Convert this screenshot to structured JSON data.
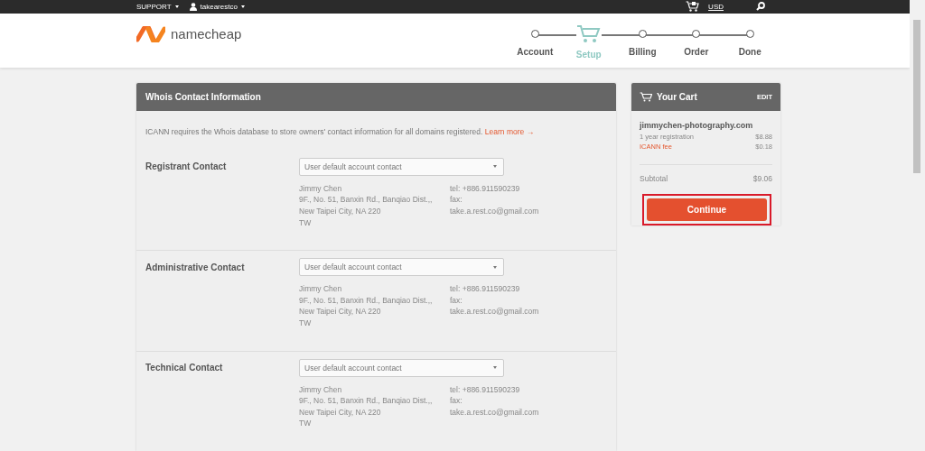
{
  "top_bar": {
    "support": "SUPPORT",
    "username": "takearestco",
    "currency": "USD"
  },
  "header": {
    "logo": "namecheap",
    "steps": [
      {
        "label": "Account",
        "selected": false
      },
      {
        "label": "Setup",
        "selected": true
      },
      {
        "label": "Billing",
        "selected": false
      },
      {
        "label": "Order",
        "selected": false
      },
      {
        "label": "Done",
        "selected": false
      }
    ]
  },
  "whois": {
    "title": "Whois Contact Information",
    "intro": "ICANN requires the Whois database to store owners' contact information for all domains registered.",
    "learn_more": "Learn more →",
    "contacts": [
      {
        "label": "Registrant Contact",
        "dropdown": "User default account contact",
        "address": [
          "Jimmy Chen",
          "9F., No. 51, Banxin Rd., Banqiao Dist.,,",
          "New Taipei City, NA 220",
          "TW"
        ],
        "tel": "tel: +886.911590239",
        "fax": "fax:",
        "email": "take.a.rest.co@gmail.com"
      },
      {
        "label": "Administrative Contact",
        "dropdown": "User default account contact",
        "address": [
          "Jimmy Chen",
          "9F., No. 51, Banxin Rd., Banqiao Dist.,,",
          "New Taipei City, NA 220",
          "TW"
        ],
        "tel": "tel: +886.911590239",
        "fax": "fax:",
        "email": "take.a.rest.co@gmail.com"
      },
      {
        "label": "Technical Contact",
        "dropdown": "User default account contact",
        "address": [
          "Jimmy Chen",
          "9F., No. 51, Banxin Rd., Banqiao Dist.,,",
          "New Taipei City, NA 220",
          "TW"
        ],
        "tel": "tel: +886.911590239",
        "fax": "fax:",
        "email": "take.a.rest.co@gmail.com"
      }
    ]
  },
  "cart": {
    "title": "Your Cart",
    "edit": "EDIT",
    "domain": "jimmychen-photography.com",
    "lines": [
      {
        "label": "1 year registration",
        "price": "$8.88",
        "kind": "plain"
      },
      {
        "label": "ICANN fee",
        "price": "$0.18",
        "kind": "fee"
      }
    ],
    "subtotal_label": "Subtotal",
    "subtotal": "$9.06",
    "button": "Continue",
    "button_highlighted": true
  }
}
